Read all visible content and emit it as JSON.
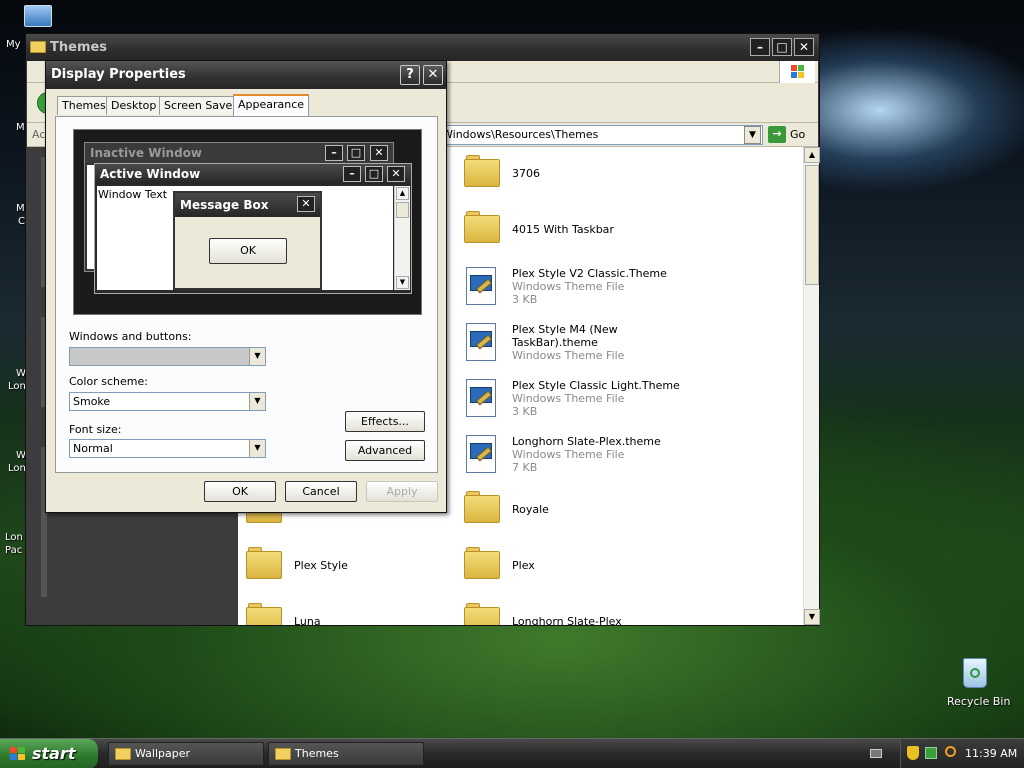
{
  "desktop": {
    "icons": {
      "my_computer": "My",
      "recycle_bin": "Recycle Bin"
    },
    "partial_labels": [
      "M",
      "M",
      "C",
      "W",
      "Lon",
      "W",
      "Lon",
      "Lon",
      "Pac"
    ]
  },
  "explorer": {
    "title": "Themes",
    "address": "Windows\\Resources\\Themes",
    "go_label": "Go",
    "left_partial": "Ac",
    "items": [
      {
        "name": "3706",
        "kind": "folder"
      },
      {
        "name": "4015 With Taskbar",
        "kind": "folder"
      },
      {
        "name": "Plex Style V2 Classic.Theme",
        "type": "Windows Theme File",
        "size": "3 KB",
        "kind": "theme"
      },
      {
        "name": "Plex Style M4 (New TaskBar).theme",
        "type": "Windows Theme File",
        "kind": "theme"
      },
      {
        "name": "Plex Style Classic Light.Theme",
        "type": "Windows Theme File",
        "size": "3 KB",
        "kind": "theme"
      },
      {
        "name": "Longhorn Slate-Plex.theme",
        "type": "Windows Theme File",
        "size": "7 KB",
        "kind": "theme"
      },
      {
        "name": "Royale",
        "kind": "folder"
      },
      {
        "name": "Plex",
        "kind": "folder"
      },
      {
        "name": "Longhorn Slate-Plex",
        "kind": "folder"
      },
      {
        "name": "Plex Style",
        "kind": "folder"
      },
      {
        "name": "Luna",
        "kind": "folder"
      }
    ]
  },
  "dialog": {
    "title": "Display Properties",
    "help_button": "?",
    "close_button": "✕",
    "tabs": [
      "Themes",
      "Desktop",
      "Screen Saver",
      "Appearance"
    ],
    "active_tab": "Appearance",
    "preview": {
      "inactive_title": "Inactive Window",
      "active_title": "Active Window",
      "window_text": "Window Text",
      "message_box_title": "Message Box",
      "ok": "OK"
    },
    "windows_buttons_label": "Windows and buttons:",
    "windows_buttons_value": "",
    "color_scheme_label": "Color scheme:",
    "color_scheme_value": "Smoke",
    "font_size_label": "Font size:",
    "font_size_value": "Normal",
    "effects_button": "Effects...",
    "advanced_button": "Advanced",
    "ok_button": "OK",
    "cancel_button": "Cancel",
    "apply_button": "Apply"
  },
  "taskbar": {
    "start": "start",
    "tasks": [
      "Wallpaper",
      "Themes"
    ],
    "clock": "11:39 AM"
  },
  "colors": {
    "accent": "#e68b2c",
    "titlebar": "#2e2e2e",
    "start_green": "#2e7a2e"
  }
}
